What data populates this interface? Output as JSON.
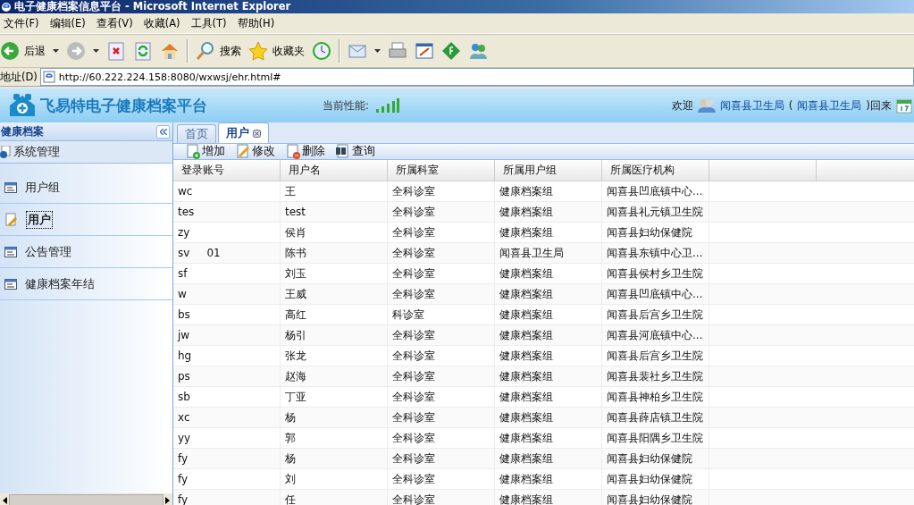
{
  "window": {
    "title": "电子健康档案信息平台 - Microsoft Internet Explorer"
  },
  "menu": [
    "文件(F)",
    "编辑(E)",
    "查看(V)",
    "收藏(A)",
    "工具(T)",
    "帮助(H)"
  ],
  "toolbar": [
    {
      "kind": "back",
      "label": "后退"
    },
    {
      "kind": "forward"
    },
    {
      "kind": "stop"
    },
    {
      "kind": "refresh"
    },
    {
      "kind": "home"
    },
    {
      "kind": "search",
      "label": "搜索"
    },
    {
      "kind": "favorites",
      "label": "收藏夹"
    },
    {
      "kind": "history"
    },
    {
      "kind": "mail"
    },
    {
      "kind": "print"
    },
    {
      "kind": "edit"
    },
    {
      "kind": "app"
    },
    {
      "kind": "messenger"
    }
  ],
  "address": {
    "label": "地址(D)",
    "url": "http://60.222.224.158:8080/wxwsj/ehr.html#"
  },
  "app_header": {
    "logo": "飞易特电子健康档案平台",
    "performance_label": "当前性能:",
    "welcome": "欢迎",
    "user": "闻喜县卫生局",
    "paren_open": "(",
    "org": "闻喜县卫生局",
    "paren_close": ")回来"
  },
  "sidebar": {
    "title": "健康档案",
    "section": "系统管理",
    "items": [
      {
        "label": "用户组",
        "selected": false
      },
      {
        "label": "用户",
        "selected": true
      },
      {
        "label": "公告管理",
        "selected": false
      },
      {
        "label": "健康档案年结",
        "selected": false
      }
    ]
  },
  "tabs": [
    {
      "label": "首页",
      "selected": false,
      "closable": false
    },
    {
      "label": "用户",
      "selected": true,
      "closable": true
    }
  ],
  "actions": [
    {
      "kind": "add",
      "label": "增加"
    },
    {
      "kind": "edit",
      "label": "修改"
    },
    {
      "kind": "delete",
      "label": "删除"
    },
    {
      "kind": "query",
      "label": "查询"
    }
  ],
  "table": {
    "columns": [
      "登录账号",
      "用户名",
      "所属科室",
      "所属用户组",
      "所属医疗机构"
    ],
    "rows": [
      [
        "wc",
        "王",
        "全科诊室",
        "健康档案组",
        "闻喜县凹底镇中心..."
      ],
      [
        "tes",
        "test",
        "全科诊室",
        "健康档案组",
        "闻喜县礼元镇卫生院"
      ],
      [
        "zy",
        "侯肖",
        "全科诊室",
        "健康档案组",
        "闻喜县妇幼保健院"
      ],
      [
        "sv     01",
        "陈书",
        "全科诊室",
        "闻喜县卫生局",
        "闻喜县东镇中心卫..."
      ],
      [
        "sf",
        "刘玉",
        "全科诊室",
        "健康档案组",
        "闻喜县侯村乡卫生院"
      ],
      [
        "w",
        "王威",
        "全科诊室",
        "健康档案组",
        "闻喜县凹底镇中心..."
      ],
      [
        "bs",
        "高红",
        "科诊室",
        "健康档案组",
        "闻喜县后宫乡卫生院"
      ],
      [
        "jw",
        "杨引",
        "全科诊室",
        "健康档案组",
        "闻喜县河底镇中心..."
      ],
      [
        "hg",
        "张龙",
        "全科诊室",
        "健康档案组",
        "闻喜县后宫乡卫生院"
      ],
      [
        "ps",
        "赵海",
        "全科诊室",
        "健康档案组",
        "闻喜县裴社乡卫生院"
      ],
      [
        "sb",
        "丁亚",
        "全科诊室",
        "健康档案组",
        "闻喜县神柏乡卫生院"
      ],
      [
        "xc",
        "杨",
        "全科诊室",
        "健康档案组",
        "闻喜县薛店镇卫生院"
      ],
      [
        "yy",
        "郭",
        "全科诊室",
        "健康档案组",
        "闻喜县阳隅乡卫生院"
      ],
      [
        "fy",
        "杨",
        "全科诊室",
        "健康档案组",
        "闻喜县妇幼保健院"
      ],
      [
        "fy",
        "刘",
        "全科诊室",
        "健康档案组",
        "闻喜县妇幼保健院"
      ],
      [
        "fy",
        "任",
        "全科诊室",
        "健康档案组",
        "闻喜县妇幼保健院"
      ]
    ]
  }
}
